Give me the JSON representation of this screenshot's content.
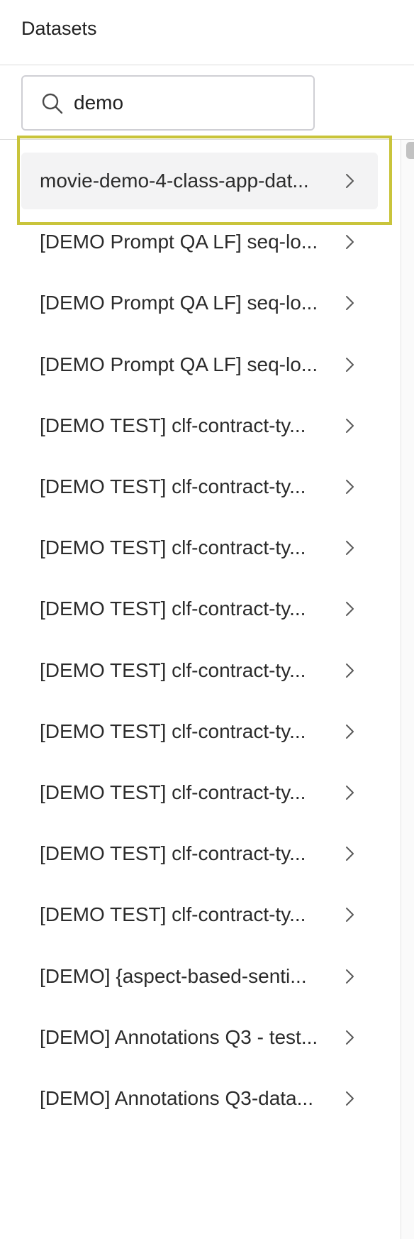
{
  "header": {
    "title": "Datasets"
  },
  "search": {
    "value": "demo",
    "icon": "search-icon"
  },
  "list": {
    "items": [
      {
        "label": "movie-demo-4-class-app-dat...",
        "selected": true
      },
      {
        "label": "[DEMO Prompt QA LF] seq-lo...",
        "selected": false
      },
      {
        "label": "[DEMO Prompt QA LF] seq-lo...",
        "selected": false
      },
      {
        "label": "[DEMO Prompt QA LF] seq-lo...",
        "selected": false
      },
      {
        "label": "[DEMO TEST] clf-contract-ty...",
        "selected": false
      },
      {
        "label": "[DEMO TEST] clf-contract-ty...",
        "selected": false
      },
      {
        "label": "[DEMO TEST] clf-contract-ty...",
        "selected": false
      },
      {
        "label": "[DEMO TEST] clf-contract-ty...",
        "selected": false
      },
      {
        "label": "[DEMO TEST] clf-contract-ty...",
        "selected": false
      },
      {
        "label": "[DEMO TEST] clf-contract-ty...",
        "selected": false
      },
      {
        "label": "[DEMO TEST] clf-contract-ty...",
        "selected": false
      },
      {
        "label": "[DEMO TEST] clf-contract-ty...",
        "selected": false
      },
      {
        "label": "[DEMO TEST] clf-contract-ty...",
        "selected": false
      },
      {
        "label": "[DEMO] {aspect-based-senti...",
        "selected": false
      },
      {
        "label": "[DEMO] Annotations Q3 - test...",
        "selected": false
      },
      {
        "label": "[DEMO] Annotations Q3-data...",
        "selected": false
      }
    ],
    "chevron_icon": "chevron-right-icon"
  },
  "colors": {
    "highlight_border": "#c9c43b",
    "selected_bg": "#f3f3f4",
    "divider": "#dcdcdc"
  }
}
